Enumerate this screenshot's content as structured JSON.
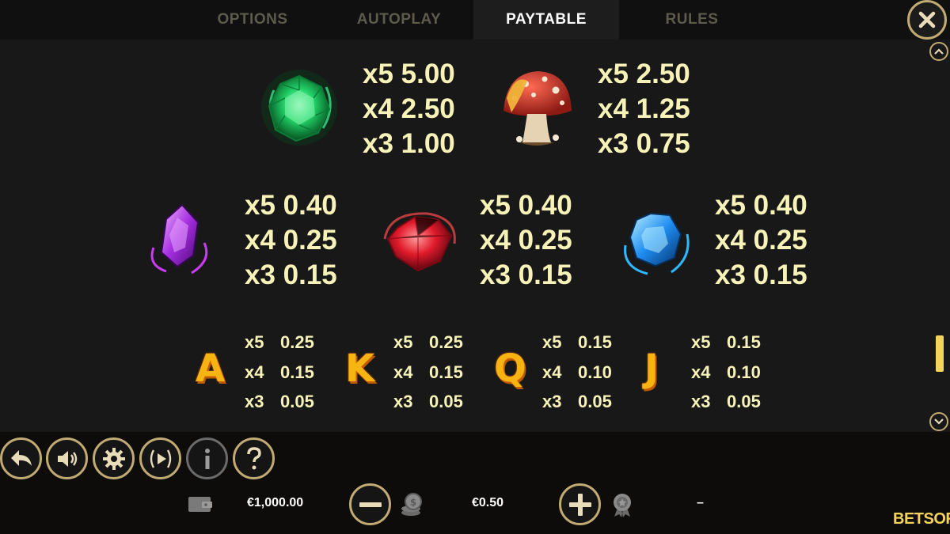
{
  "tabs": [
    {
      "label": "OPTIONS",
      "active": false
    },
    {
      "label": "AUTOPLAY",
      "active": false
    },
    {
      "label": "PAYTABLE",
      "active": true
    },
    {
      "label": "RULES",
      "active": false
    }
  ],
  "paytable": {
    "emerald": [
      "x5 5.00",
      "x4 2.50",
      "x3 1.00"
    ],
    "mushroom": [
      "x5 2.50",
      "x4 1.25",
      "x3 0.75"
    ],
    "amethyst": [
      "x5 0.40",
      "x4 0.25",
      "x3 0.15"
    ],
    "ruby": [
      "x5 0.40",
      "x4 0.25",
      "x3 0.15"
    ],
    "sapphire": [
      "x5 0.40",
      "x4 0.25",
      "x3 0.15"
    ],
    "cards": [
      {
        "letter": "A",
        "rows": [
          [
            "x5",
            "0.25"
          ],
          [
            "x4",
            "0.15"
          ],
          [
            "x3",
            "0.05"
          ]
        ]
      },
      {
        "letter": "K",
        "rows": [
          [
            "x5",
            "0.25"
          ],
          [
            "x4",
            "0.15"
          ],
          [
            "x3",
            "0.05"
          ]
        ]
      },
      {
        "letter": "Q",
        "rows": [
          [
            "x5",
            "0.15"
          ],
          [
            "x4",
            "0.10"
          ],
          [
            "x3",
            "0.05"
          ]
        ]
      },
      {
        "letter": "J",
        "rows": [
          [
            "x5",
            "0.15"
          ],
          [
            "x4",
            "0.10"
          ],
          [
            "x3",
            "0.05"
          ]
        ]
      }
    ]
  },
  "bottom": {
    "balance": "€1,000.00",
    "bet": "€0.50",
    "win": "–",
    "logo": "BETSOFT"
  },
  "colors": {
    "accent": "#c2ab73",
    "text": "#f6f2b8",
    "background": "#181818",
    "letter": "#f6b413"
  }
}
